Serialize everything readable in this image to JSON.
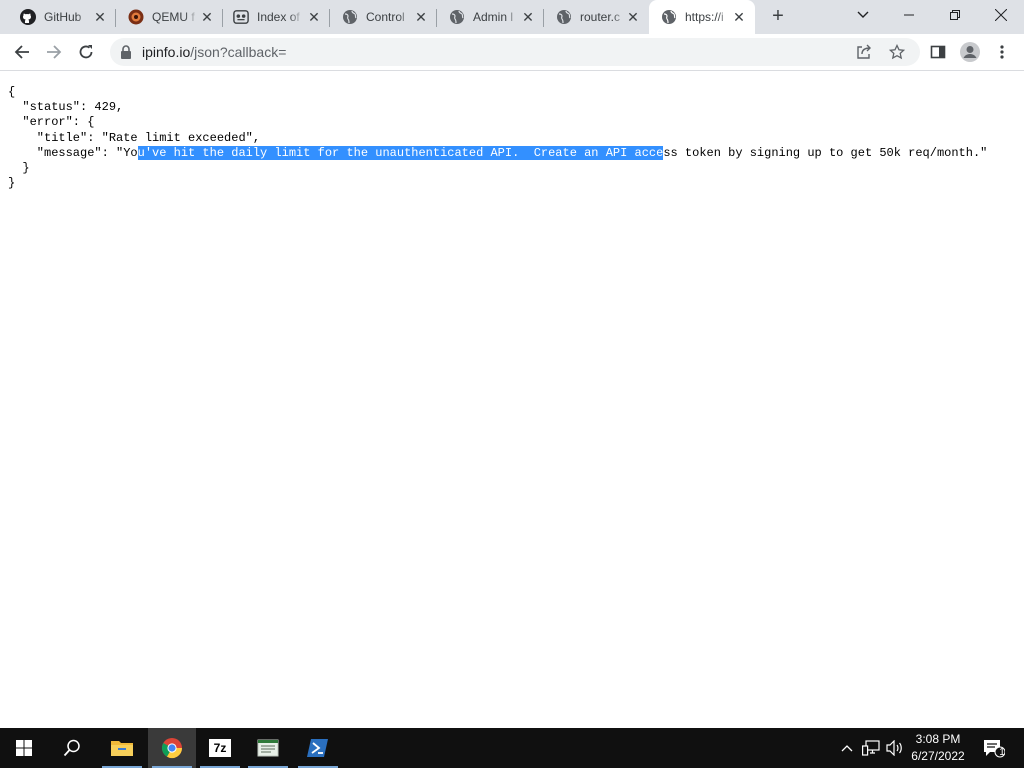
{
  "browser": {
    "tabs": [
      {
        "title": "GitHub",
        "icon": "github-icon"
      },
      {
        "title": "QEMU f",
        "icon": "qemu-icon"
      },
      {
        "title": "Index of",
        "icon": "index-icon"
      },
      {
        "title": "Control",
        "icon": "globe-icon"
      },
      {
        "title": "Admin l",
        "icon": "globe-icon"
      },
      {
        "title": "router.c",
        "icon": "globe-icon"
      },
      {
        "title": "https://i",
        "icon": "globe-icon",
        "active": true
      }
    ],
    "url_host": "ipinfo.io",
    "url_path": "/json?callback="
  },
  "json_view": {
    "line1": "{",
    "line2": "  \"status\": 429,",
    "line3": "  \"error\": {",
    "line4": "    \"title\": \"Rate limit exceeded\",",
    "line5_before": "    \"message\": \"Yo",
    "line5_selected": "u've hit the daily limit for the unauthenticated API.  Create an API acce",
    "line5_after": "ss token by signing up to get 50k req/month.\"",
    "line6": "  }",
    "line7": "}"
  },
  "taskbar": {
    "apps": [
      "start-icon",
      "search-icon",
      "file-explorer-icon",
      "chrome-icon",
      "7zip-icon",
      "notepad-icon",
      "powershell-icon"
    ],
    "active_app": "chrome-icon",
    "sevenzip_label": "7z",
    "notification_count": "1",
    "time": "3:08 PM",
    "date": "6/27/2022"
  },
  "colors": {
    "selection": "#3390ff",
    "tabstrip": "#dee1e6",
    "taskbar": "#101010"
  }
}
